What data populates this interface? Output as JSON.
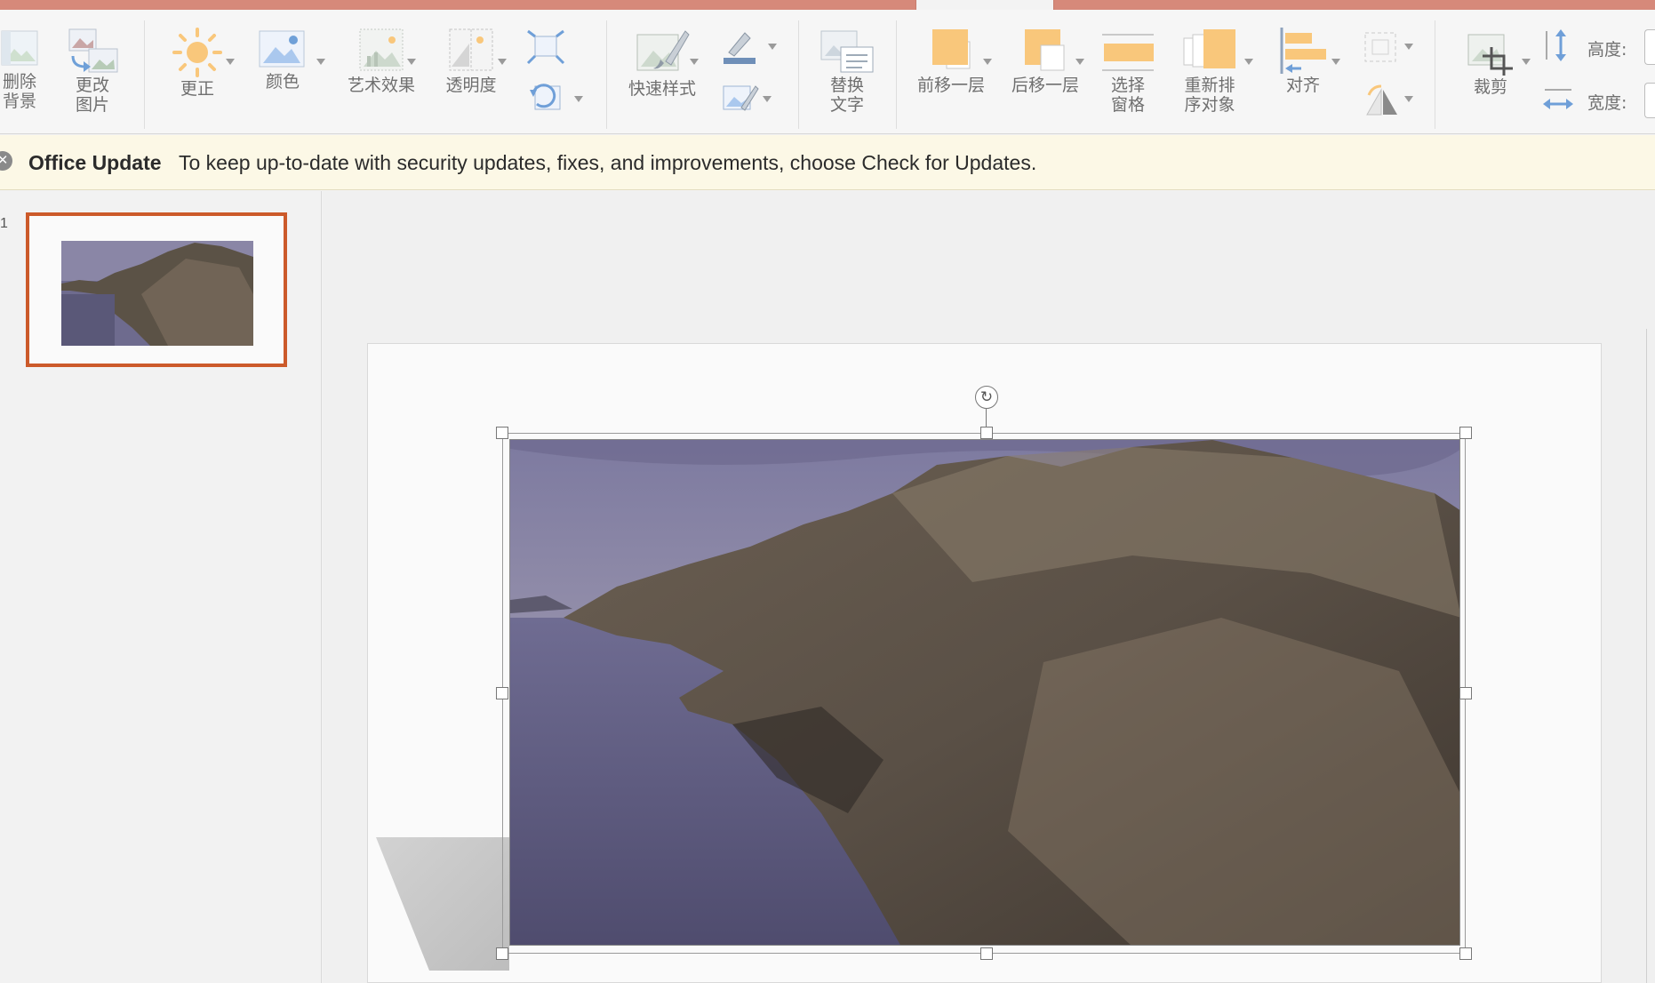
{
  "ribbon": {
    "remove_bg": [
      "删除",
      "背景"
    ],
    "change_pic": [
      "更改",
      "图片"
    ],
    "corrections": "更正",
    "color": "颜色",
    "artistic": "艺术效果",
    "transparency": "透明度",
    "quick_styles": "快速样式",
    "alt_text": [
      "替换",
      "文字"
    ],
    "bring_forward": "前移一层",
    "send_backward": "后移一层",
    "selection_pane": [
      "选择",
      "窗格"
    ],
    "reorder": [
      "重新排",
      "序对象"
    ],
    "align": "对齐",
    "crop": "裁剪",
    "height_label": "高度:",
    "width_label": "宽度:"
  },
  "notification": {
    "title": "Office Update",
    "message": "To keep up-to-date with security updates, fixes, and improvements, choose Check for Updates."
  },
  "thumbnails": {
    "number": "1"
  },
  "colors": {
    "accent": "#cc5a2a",
    "tab_strip": "#d6897a",
    "icon_orange": "#f9c77b",
    "notify_bg": "#fcf8e6"
  }
}
